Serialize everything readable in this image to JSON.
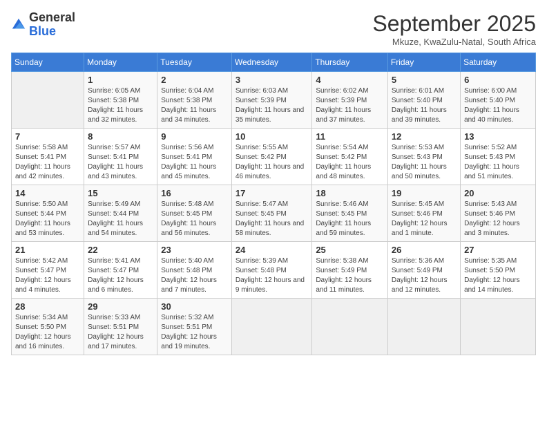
{
  "logo": {
    "text_general": "General",
    "text_blue": "Blue"
  },
  "header": {
    "month": "September 2025",
    "location": "Mkuze, KwaZulu-Natal, South Africa"
  },
  "weekdays": [
    "Sunday",
    "Monday",
    "Tuesday",
    "Wednesday",
    "Thursday",
    "Friday",
    "Saturday"
  ],
  "weeks": [
    [
      {
        "day": "",
        "sunrise": "",
        "sunset": "",
        "daylight": ""
      },
      {
        "day": "1",
        "sunrise": "Sunrise: 6:05 AM",
        "sunset": "Sunset: 5:38 PM",
        "daylight": "Daylight: 11 hours and 32 minutes."
      },
      {
        "day": "2",
        "sunrise": "Sunrise: 6:04 AM",
        "sunset": "Sunset: 5:38 PM",
        "daylight": "Daylight: 11 hours and 34 minutes."
      },
      {
        "day": "3",
        "sunrise": "Sunrise: 6:03 AM",
        "sunset": "Sunset: 5:39 PM",
        "daylight": "Daylight: 11 hours and 35 minutes."
      },
      {
        "day": "4",
        "sunrise": "Sunrise: 6:02 AM",
        "sunset": "Sunset: 5:39 PM",
        "daylight": "Daylight: 11 hours and 37 minutes."
      },
      {
        "day": "5",
        "sunrise": "Sunrise: 6:01 AM",
        "sunset": "Sunset: 5:40 PM",
        "daylight": "Daylight: 11 hours and 39 minutes."
      },
      {
        "day": "6",
        "sunrise": "Sunrise: 6:00 AM",
        "sunset": "Sunset: 5:40 PM",
        "daylight": "Daylight: 11 hours and 40 minutes."
      }
    ],
    [
      {
        "day": "7",
        "sunrise": "Sunrise: 5:58 AM",
        "sunset": "Sunset: 5:41 PM",
        "daylight": "Daylight: 11 hours and 42 minutes."
      },
      {
        "day": "8",
        "sunrise": "Sunrise: 5:57 AM",
        "sunset": "Sunset: 5:41 PM",
        "daylight": "Daylight: 11 hours and 43 minutes."
      },
      {
        "day": "9",
        "sunrise": "Sunrise: 5:56 AM",
        "sunset": "Sunset: 5:41 PM",
        "daylight": "Daylight: 11 hours and 45 minutes."
      },
      {
        "day": "10",
        "sunrise": "Sunrise: 5:55 AM",
        "sunset": "Sunset: 5:42 PM",
        "daylight": "Daylight: 11 hours and 46 minutes."
      },
      {
        "day": "11",
        "sunrise": "Sunrise: 5:54 AM",
        "sunset": "Sunset: 5:42 PM",
        "daylight": "Daylight: 11 hours and 48 minutes."
      },
      {
        "day": "12",
        "sunrise": "Sunrise: 5:53 AM",
        "sunset": "Sunset: 5:43 PM",
        "daylight": "Daylight: 11 hours and 50 minutes."
      },
      {
        "day": "13",
        "sunrise": "Sunrise: 5:52 AM",
        "sunset": "Sunset: 5:43 PM",
        "daylight": "Daylight: 11 hours and 51 minutes."
      }
    ],
    [
      {
        "day": "14",
        "sunrise": "Sunrise: 5:50 AM",
        "sunset": "Sunset: 5:44 PM",
        "daylight": "Daylight: 11 hours and 53 minutes."
      },
      {
        "day": "15",
        "sunrise": "Sunrise: 5:49 AM",
        "sunset": "Sunset: 5:44 PM",
        "daylight": "Daylight: 11 hours and 54 minutes."
      },
      {
        "day": "16",
        "sunrise": "Sunrise: 5:48 AM",
        "sunset": "Sunset: 5:45 PM",
        "daylight": "Daylight: 11 hours and 56 minutes."
      },
      {
        "day": "17",
        "sunrise": "Sunrise: 5:47 AM",
        "sunset": "Sunset: 5:45 PM",
        "daylight": "Daylight: 11 hours and 58 minutes."
      },
      {
        "day": "18",
        "sunrise": "Sunrise: 5:46 AM",
        "sunset": "Sunset: 5:45 PM",
        "daylight": "Daylight: 11 hours and 59 minutes."
      },
      {
        "day": "19",
        "sunrise": "Sunrise: 5:45 AM",
        "sunset": "Sunset: 5:46 PM",
        "daylight": "Daylight: 12 hours and 1 minute."
      },
      {
        "day": "20",
        "sunrise": "Sunrise: 5:43 AM",
        "sunset": "Sunset: 5:46 PM",
        "daylight": "Daylight: 12 hours and 3 minutes."
      }
    ],
    [
      {
        "day": "21",
        "sunrise": "Sunrise: 5:42 AM",
        "sunset": "Sunset: 5:47 PM",
        "daylight": "Daylight: 12 hours and 4 minutes."
      },
      {
        "day": "22",
        "sunrise": "Sunrise: 5:41 AM",
        "sunset": "Sunset: 5:47 PM",
        "daylight": "Daylight: 12 hours and 6 minutes."
      },
      {
        "day": "23",
        "sunrise": "Sunrise: 5:40 AM",
        "sunset": "Sunset: 5:48 PM",
        "daylight": "Daylight: 12 hours and 7 minutes."
      },
      {
        "day": "24",
        "sunrise": "Sunrise: 5:39 AM",
        "sunset": "Sunset: 5:48 PM",
        "daylight": "Daylight: 12 hours and 9 minutes."
      },
      {
        "day": "25",
        "sunrise": "Sunrise: 5:38 AM",
        "sunset": "Sunset: 5:49 PM",
        "daylight": "Daylight: 12 hours and 11 minutes."
      },
      {
        "day": "26",
        "sunrise": "Sunrise: 5:36 AM",
        "sunset": "Sunset: 5:49 PM",
        "daylight": "Daylight: 12 hours and 12 minutes."
      },
      {
        "day": "27",
        "sunrise": "Sunrise: 5:35 AM",
        "sunset": "Sunset: 5:50 PM",
        "daylight": "Daylight: 12 hours and 14 minutes."
      }
    ],
    [
      {
        "day": "28",
        "sunrise": "Sunrise: 5:34 AM",
        "sunset": "Sunset: 5:50 PM",
        "daylight": "Daylight: 12 hours and 16 minutes."
      },
      {
        "day": "29",
        "sunrise": "Sunrise: 5:33 AM",
        "sunset": "Sunset: 5:51 PM",
        "daylight": "Daylight: 12 hours and 17 minutes."
      },
      {
        "day": "30",
        "sunrise": "Sunrise: 5:32 AM",
        "sunset": "Sunset: 5:51 PM",
        "daylight": "Daylight: 12 hours and 19 minutes."
      },
      {
        "day": "",
        "sunrise": "",
        "sunset": "",
        "daylight": ""
      },
      {
        "day": "",
        "sunrise": "",
        "sunset": "",
        "daylight": ""
      },
      {
        "day": "",
        "sunrise": "",
        "sunset": "",
        "daylight": ""
      },
      {
        "day": "",
        "sunrise": "",
        "sunset": "",
        "daylight": ""
      }
    ]
  ]
}
